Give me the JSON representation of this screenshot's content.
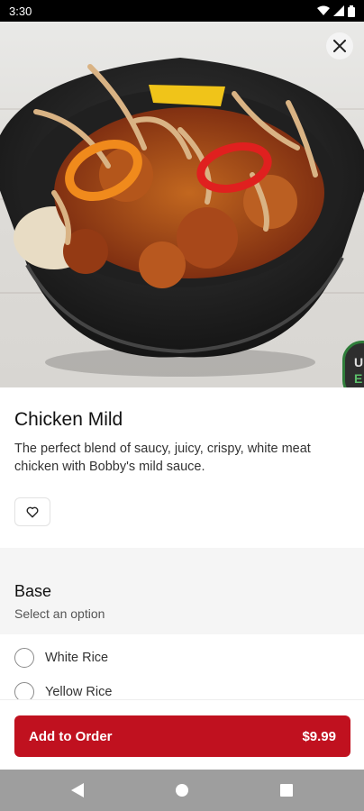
{
  "status_bar": {
    "time": "3:30"
  },
  "item": {
    "name": "Chicken Mild",
    "description": "The perfect blend of saucy, juicy, crispy, white meat chicken with Bobby's mild sauce."
  },
  "badge": {
    "text_line1": "U",
    "text_line2": "E"
  },
  "section": {
    "title": "Base",
    "subtitle": "Select an option",
    "options": [
      {
        "label": "White Rice",
        "selected": false
      },
      {
        "label": "Yellow Rice",
        "selected": false
      }
    ]
  },
  "footer": {
    "button_label": "Add to Order",
    "price": "$9.99"
  },
  "icons": {
    "close": "close-icon",
    "favorite": "heart-outline-icon",
    "wifi": "wifi-icon",
    "signal": "signal-icon",
    "battery": "battery-icon",
    "back": "back-triangle-icon",
    "home": "home-circle-icon",
    "recents": "recents-square-icon"
  },
  "colors": {
    "accent": "#c0111f",
    "badge_ring": "#2f7d3a"
  }
}
